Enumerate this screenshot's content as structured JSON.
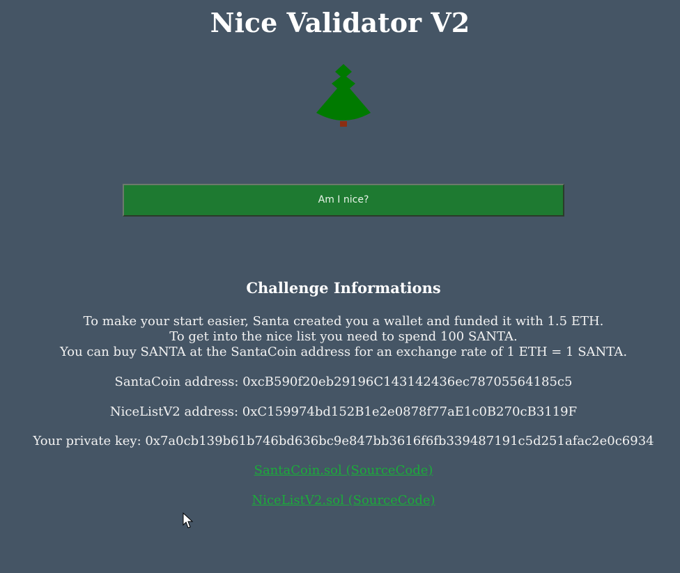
{
  "page": {
    "title": "Nice Validator V2"
  },
  "action": {
    "button_label": "Am I nice?"
  },
  "challenge": {
    "heading": "Challenge Informations",
    "lines": [
      "To make your start easier, Santa created you a wallet and funded it with 1.5 ETH.",
      "To get into the nice list you need to spend 100 SANTA.",
      "You can buy SANTA at the SantaCoin address for an exchange rate of 1 ETH = 1 SANTA."
    ],
    "santacoin_address": "SantaCoin address: 0xcB590f20eb29196C143142436ec78705564185c5",
    "nicelist_address": "NiceListV2 address: 0xC159974bd152B1e2e0878f77aE1c0B270cB3119F",
    "private_key": "Your private key: 0x7a0cb139b61b746bd636bc9e847bb3616f6fb339487191c5d251afac2e0c6934",
    "links": [
      "SantaCoin.sol (SourceCode)",
      "NiceListV2.sol (SourceCode)"
    ]
  },
  "colors": {
    "background": "#455565",
    "button": "#1e7a31",
    "link": "#1cab3b",
    "tree": "#007a00",
    "trunk": "#8b2e12"
  },
  "icons": {
    "tree": "christmas-tree-icon",
    "cursor": "mouse-cursor-icon"
  }
}
